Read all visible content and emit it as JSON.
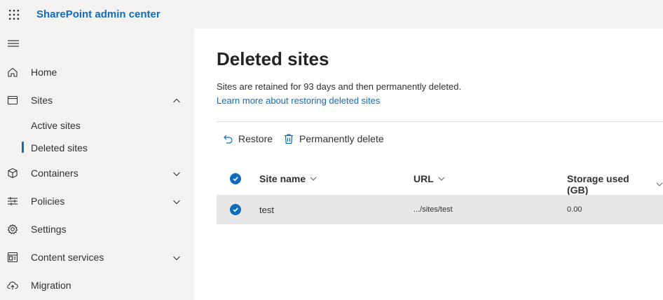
{
  "header": {
    "app_title": "SharePoint admin center",
    "waffle_icon": "app-launcher-icon"
  },
  "sidebar": {
    "toggle_icon": "hamburger-icon",
    "items": [
      {
        "label": "Home",
        "icon": "home-icon"
      },
      {
        "label": "Sites",
        "icon": "sites-icon",
        "expanded": true
      },
      {
        "label": "Containers",
        "icon": "containers-icon"
      },
      {
        "label": "Policies",
        "icon": "policies-icon"
      },
      {
        "label": "Settings",
        "icon": "settings-icon"
      },
      {
        "label": "Content services",
        "icon": "content-services-icon"
      },
      {
        "label": "Migration",
        "icon": "migration-icon"
      }
    ],
    "sub_items": [
      {
        "label": "Active sites"
      },
      {
        "label": "Deleted sites",
        "selected": true
      }
    ]
  },
  "main": {
    "title": "Deleted sites",
    "description": "Sites are retained for 93 days and then permanently deleted.",
    "learn_more": "Learn more about restoring deleted sites",
    "commands": {
      "restore": "Restore",
      "permanently_delete": "Permanently delete"
    },
    "table": {
      "columns": [
        "Site name",
        "URL",
        "Storage used (GB)"
      ],
      "rows": [
        {
          "site_name": "test",
          "url": ".../sites/test",
          "storage": "0.00",
          "selected": true
        }
      ]
    }
  },
  "colors": {
    "accent": "#0f6cbd",
    "sidebar_bg": "#f3f2f1",
    "selected_row_bg": "#e6e6e6"
  }
}
